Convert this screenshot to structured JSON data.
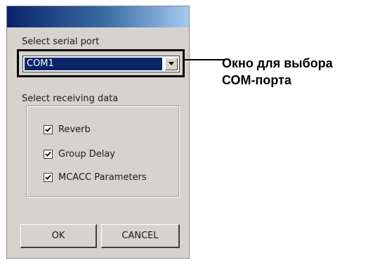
{
  "dialog": {
    "serial_port": {
      "label": "Select serial port",
      "selected_value": "COM1"
    },
    "receiving_data": {
      "label": "Select receiving data",
      "items": [
        {
          "label": "Reverb",
          "checked": true
        },
        {
          "label": "Group Delay",
          "checked": true
        },
        {
          "label": "MCACC Parameters",
          "checked": true
        }
      ]
    },
    "buttons": {
      "ok_label": "OK",
      "cancel_label": "CANCEL"
    }
  },
  "callout": {
    "line1": "Окно для выбора",
    "line2": "СОМ-порта"
  },
  "colors": {
    "titlebar_start": "#0a246a",
    "titlebar_end": "#a6caf0",
    "selection": "#0a246a",
    "dialog_bg": "#d6d3ce"
  }
}
